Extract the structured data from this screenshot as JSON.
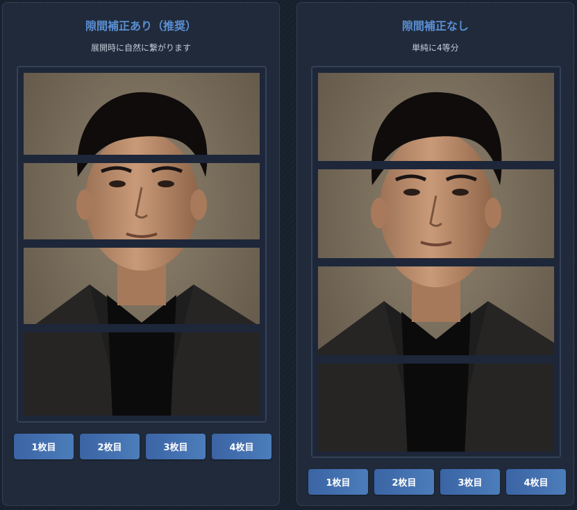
{
  "left_panel": {
    "title": "隙間補正あり（推奨）",
    "subtitle": "展開時に自然に繋がります",
    "buttons": [
      "1枚目",
      "2枚目",
      "3枚目",
      "4枚目"
    ]
  },
  "right_panel": {
    "title": "隙間補正なし",
    "subtitle": "単純に4等分",
    "buttons": [
      "1枚目",
      "2枚目",
      "3枚目",
      "4枚目"
    ]
  },
  "image": {
    "subject": "portrait-photo-of-man-in-dark-jacket"
  },
  "colors": {
    "accent": "#5b8fd4",
    "button": "#4170ae",
    "panel": "#202a3a"
  }
}
